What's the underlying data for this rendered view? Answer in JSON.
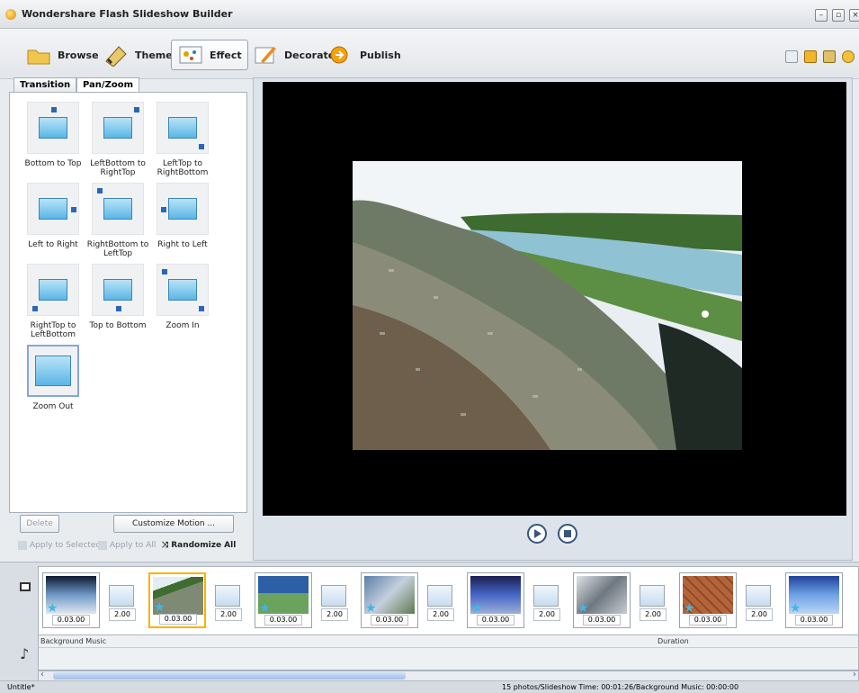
{
  "window": {
    "title": "Wondershare Flash Slideshow Builder"
  },
  "toolbar": {
    "buttons": [
      {
        "label": "Browse"
      },
      {
        "label": "Theme"
      },
      {
        "label": "Effect"
      },
      {
        "label": "Decorate"
      },
      {
        "label": "Publish"
      }
    ]
  },
  "left_panel": {
    "tabs": [
      {
        "label": "Transition"
      },
      {
        "label": "Pan/Zoom"
      }
    ],
    "active_tab": "Pan/Zoom",
    "effects": [
      {
        "label": "Bottom to Top",
        "icon": "arrow-up-icon"
      },
      {
        "label": "LeftBottom to RightTop",
        "icon": "arrow-upright-icon"
      },
      {
        "label": "LeftTop to RightBottom",
        "icon": "arrow-downright-icon"
      },
      {
        "label": "Left to Right",
        "icon": "arrow-right-icon"
      },
      {
        "label": "RightBottom to LeftTop",
        "icon": "arrow-upleft-icon"
      },
      {
        "label": "Right to Left",
        "icon": "arrow-left-icon"
      },
      {
        "label": "RightTop to LeftBottom",
        "icon": "arrow-downleft-icon"
      },
      {
        "label": "Top to Bottom",
        "icon": "arrow-down-icon"
      },
      {
        "label": "Zoom In",
        "icon": "zoom-in-icon"
      },
      {
        "label": "Zoom Out",
        "icon": "zoom-out-icon"
      }
    ],
    "delete_label": "Delete",
    "customize_label": "Customize Motion ...",
    "apply_selected_label": "Apply to Selected",
    "apply_all_label": "Apply to All",
    "randomize_label": "Randomize All"
  },
  "timeline": {
    "slides": [
      {
        "duration": "0.03.00",
        "color": "#4b6f8c"
      },
      {
        "duration": "0.03.00",
        "color": "#6e7b4d",
        "selected": true
      },
      {
        "duration": "0.03.00",
        "color": "#3b6ea2"
      },
      {
        "duration": "0.03.00",
        "color": "#7b8aa6"
      },
      {
        "duration": "0.03.00",
        "color": "#2e3a8f"
      },
      {
        "duration": "0.03.00",
        "color": "#7e8790"
      },
      {
        "duration": "0.03.00",
        "color": "#b5643a"
      },
      {
        "duration": "0.03.00",
        "color": "#3a64c6"
      }
    ],
    "transitions": [
      "2.00",
      "2.00",
      "2.00",
      "2.00",
      "2.00",
      "2.00",
      "2.00"
    ],
    "background_music_label": "Background Music",
    "duration_label": "Duration"
  },
  "status": {
    "document": "Untitle*",
    "summary": "15 photos/Slideshow Time: 00:01:26/Background Music: 00:00:00"
  }
}
